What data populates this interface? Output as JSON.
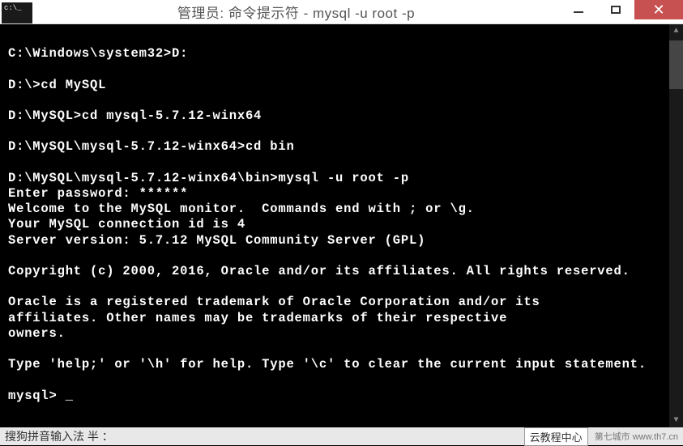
{
  "window": {
    "icon_text": "c:\\_",
    "title": "管理员: 命令提示符 - mysql  -u root -p"
  },
  "terminal": {
    "lines": [
      "",
      "C:\\Windows\\system32>D:",
      "",
      "D:\\>cd MySQL",
      "",
      "D:\\MySQL>cd mysql-5.7.12-winx64",
      "",
      "D:\\MySQL\\mysql-5.7.12-winx64>cd bin",
      "",
      "D:\\MySQL\\mysql-5.7.12-winx64\\bin>mysql -u root -p",
      "Enter password: ******",
      "Welcome to the MySQL monitor.  Commands end with ; or \\g.",
      "Your MySQL connection id is 4",
      "Server version: 5.7.12 MySQL Community Server (GPL)",
      "",
      "Copyright (c) 2000, 2016, Oracle and/or its affiliates. All rights reserved.",
      "",
      "Oracle is a registered trademark of Oracle Corporation and/or its",
      "affiliates. Other names may be trademarks of their respective",
      "owners.",
      "",
      "Type 'help;' or '\\h' for help. Type '\\c' to clear the current input statement.",
      "",
      "mysql> _"
    ]
  },
  "ime": {
    "text": "搜狗拼音输入法 半 ：",
    "tag": "云教程中心",
    "footer": "第七城市  www.th7.cn"
  }
}
